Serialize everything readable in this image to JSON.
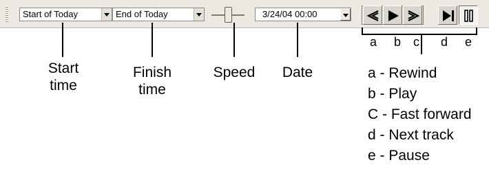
{
  "toolbar": {
    "start_time_value": "Start of Today",
    "end_time_value": "End of Today",
    "date_value": "3/24/04 00:00"
  },
  "buttons": [
    {
      "letter": "a",
      "icon": "rewind-icon"
    },
    {
      "letter": "b",
      "icon": "play-icon"
    },
    {
      "letter": "c",
      "icon": "fast-forward-icon"
    },
    {
      "letter": "d",
      "icon": "next-track-icon"
    },
    {
      "letter": "e",
      "icon": "pause-icon"
    }
  ],
  "callouts": {
    "start_time": "Start\ntime",
    "finish_time": "Finish\ntime",
    "speed": "Speed",
    "date": "Date"
  },
  "legend": [
    "a - Rewind",
    "b - Play",
    "C - Fast forward",
    "d - Next track",
    "e - Pause"
  ],
  "colors": {
    "toolbar_bg": "#ece9e2",
    "icon": "#000000"
  }
}
